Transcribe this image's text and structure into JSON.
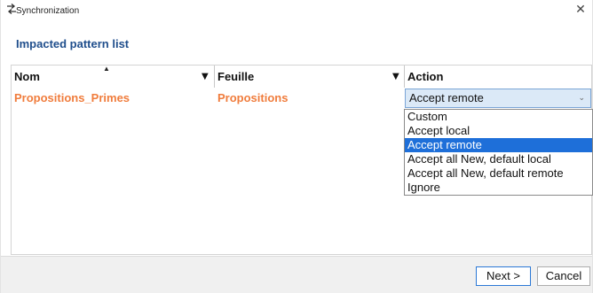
{
  "window": {
    "title": "Synchronization",
    "close_glyph": "✕"
  },
  "section_title": "Impacted pattern list",
  "table": {
    "columns": [
      {
        "label": "Nom",
        "sort_glyph": "▲",
        "filter_glyph": "▼"
      },
      {
        "label": "Feuille",
        "filter_glyph": "▼"
      },
      {
        "label": "Action"
      }
    ],
    "rows": [
      {
        "nom": "Propositions_Primes",
        "feuille": "Propositions",
        "action": "Accept remote"
      }
    ],
    "combo_chevron": "⌄"
  },
  "dropdown": {
    "options": [
      "Custom",
      "Accept local",
      "Accept remote",
      "Accept all New, default local",
      "Accept all New, default remote",
      "Ignore"
    ],
    "selected": "Accept remote"
  },
  "buttons": {
    "next": "Next >",
    "cancel": "Cancel"
  },
  "colors": {
    "accent": "#1e6fd9",
    "title": "#1f4e8c",
    "row_text": "#f07c3c"
  },
  "icons": {
    "title_icon": "sync-arrows-icon"
  }
}
